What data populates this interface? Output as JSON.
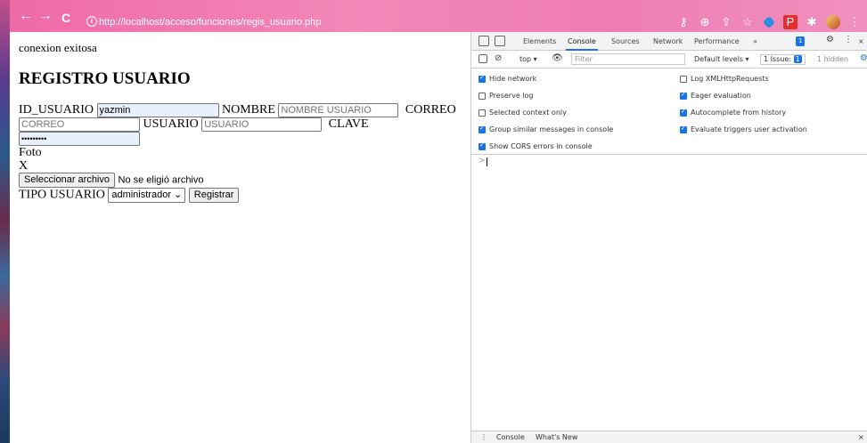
{
  "browser": {
    "back": "←",
    "forward": "→",
    "reload": "C",
    "info": "i",
    "url": "http://localhost/acceso/funciones/regis_usuario.php",
    "toolbar_icons": [
      "key-icon",
      "zoom-icon",
      "share-icon",
      "star-icon",
      "extension-blue-icon",
      "extension-red-icon",
      "puzzle-icon",
      "avatar",
      "menu-icon"
    ]
  },
  "page": {
    "status": "conexion exitosa",
    "title": "REGISTRO USUARIO",
    "id_label": "ID_USUARIO",
    "id_value": "yazmin",
    "nombre_label": "NOMBRE",
    "nombre_placeholder": "NOMBRE USUARIO",
    "correo_label": "CORREO",
    "correo_placeholder": "CORREO",
    "usuario_label": "USUARIO",
    "usuario_placeholder": "USUARIO",
    "clave_label": "CLAVE",
    "clave_value": "•••••••••",
    "foto_label": "Foto",
    "x_label": "X",
    "file_button": "Seleccionar archivo",
    "file_status": "No se eligió archivo",
    "tipo_label": "TIPO USUARIO",
    "tipo_value": "administrador",
    "submit": "Registrar"
  },
  "devtools": {
    "tabs": [
      "Elements",
      "Console",
      "Sources",
      "Network",
      "Performance"
    ],
    "active_tab": "Console",
    "more": "»",
    "issues_badge": "1",
    "context": "top ▾",
    "filter_placeholder": "Filter",
    "levels": "Default levels ▾",
    "issue_text": "1 Issue:",
    "issue_count": "1",
    "hidden": "1 hidden",
    "options_left": [
      {
        "label": "Hide network",
        "checked": true
      },
      {
        "label": "Preserve log",
        "checked": false
      },
      {
        "label": "Selected context only",
        "checked": false
      },
      {
        "label": "Group similar messages in console",
        "checked": true
      },
      {
        "label": "Show CORS errors in console",
        "checked": true
      }
    ],
    "options_right": [
      {
        "label": "Log XMLHttpRequests",
        "checked": false
      },
      {
        "label": "Eager evaluation",
        "checked": true
      },
      {
        "label": "Autocomplete from history",
        "checked": true
      },
      {
        "label": "Evaluate triggers user activation",
        "checked": true
      }
    ],
    "prompt": ">",
    "drawer_tabs": [
      "Console",
      "What's New"
    ],
    "drawer_menu": "⋮",
    "drawer_close": "×"
  }
}
